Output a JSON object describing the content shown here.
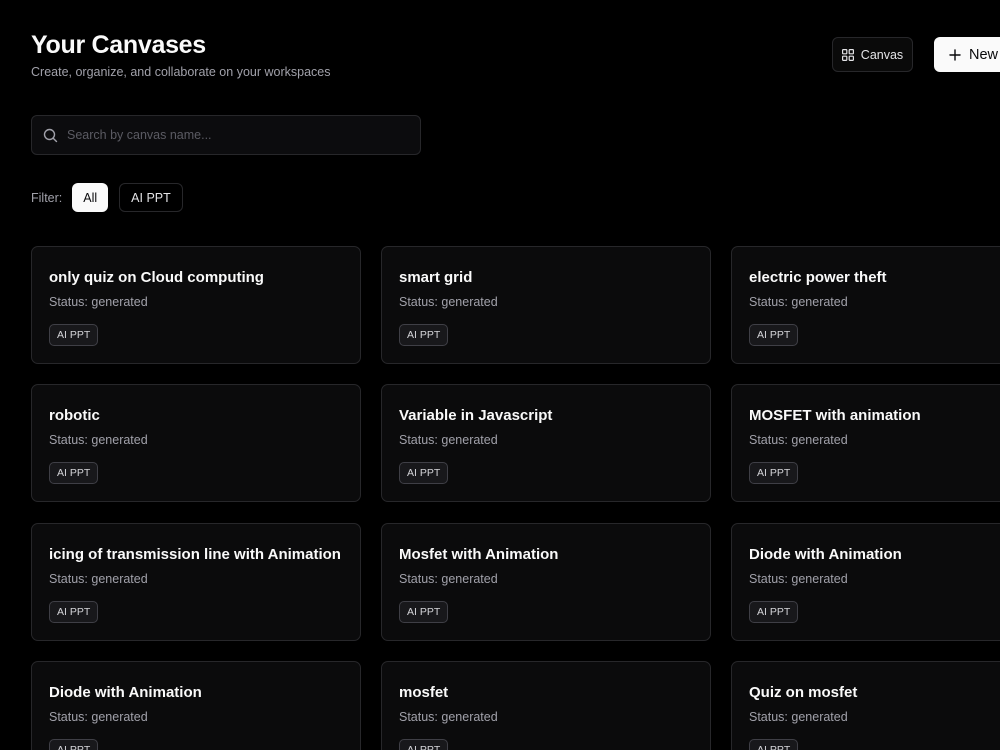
{
  "header": {
    "title": "Your Canvases",
    "subtitle": "Create, organize, and collaborate on your workspaces",
    "canvas_button_label": "Canvas",
    "new_button_label": "New"
  },
  "search": {
    "placeholder": "Search by canvas name...",
    "value": "",
    "icon": "search-icon"
  },
  "filter": {
    "label": "Filter:",
    "options": [
      {
        "label": "All",
        "active": true
      },
      {
        "label": "AI PPT",
        "active": false
      }
    ]
  },
  "canvases": [
    {
      "title": "only quiz on Cloud computing",
      "status": "Status: generated",
      "badge": "AI PPT"
    },
    {
      "title": "smart grid",
      "status": "Status: generated",
      "badge": "AI PPT"
    },
    {
      "title": "electric power theft",
      "status": "Status: generated",
      "badge": "AI PPT"
    },
    {
      "title": "robotic",
      "status": "Status: generated",
      "badge": "AI PPT"
    },
    {
      "title": "Variable in Javascript",
      "status": "Status: generated",
      "badge": "AI PPT"
    },
    {
      "title": "MOSFET with animation",
      "status": "Status: generated",
      "badge": "AI PPT"
    },
    {
      "title": "icing of transmission line with Animation",
      "status": "Status: generated",
      "badge": "AI PPT"
    },
    {
      "title": "Mosfet with Animation",
      "status": "Status: generated",
      "badge": "AI PPT"
    },
    {
      "title": "Diode with Animation",
      "status": "Status: generated",
      "badge": "AI PPT"
    },
    {
      "title": "Diode with Animation",
      "status": "Status: generated",
      "badge": "AI PPT"
    },
    {
      "title": "mosfet",
      "status": "Status: generated",
      "badge": "AI PPT"
    },
    {
      "title": "Quiz on mosfet",
      "status": "Status: generated",
      "badge": "AI PPT"
    }
  ]
}
